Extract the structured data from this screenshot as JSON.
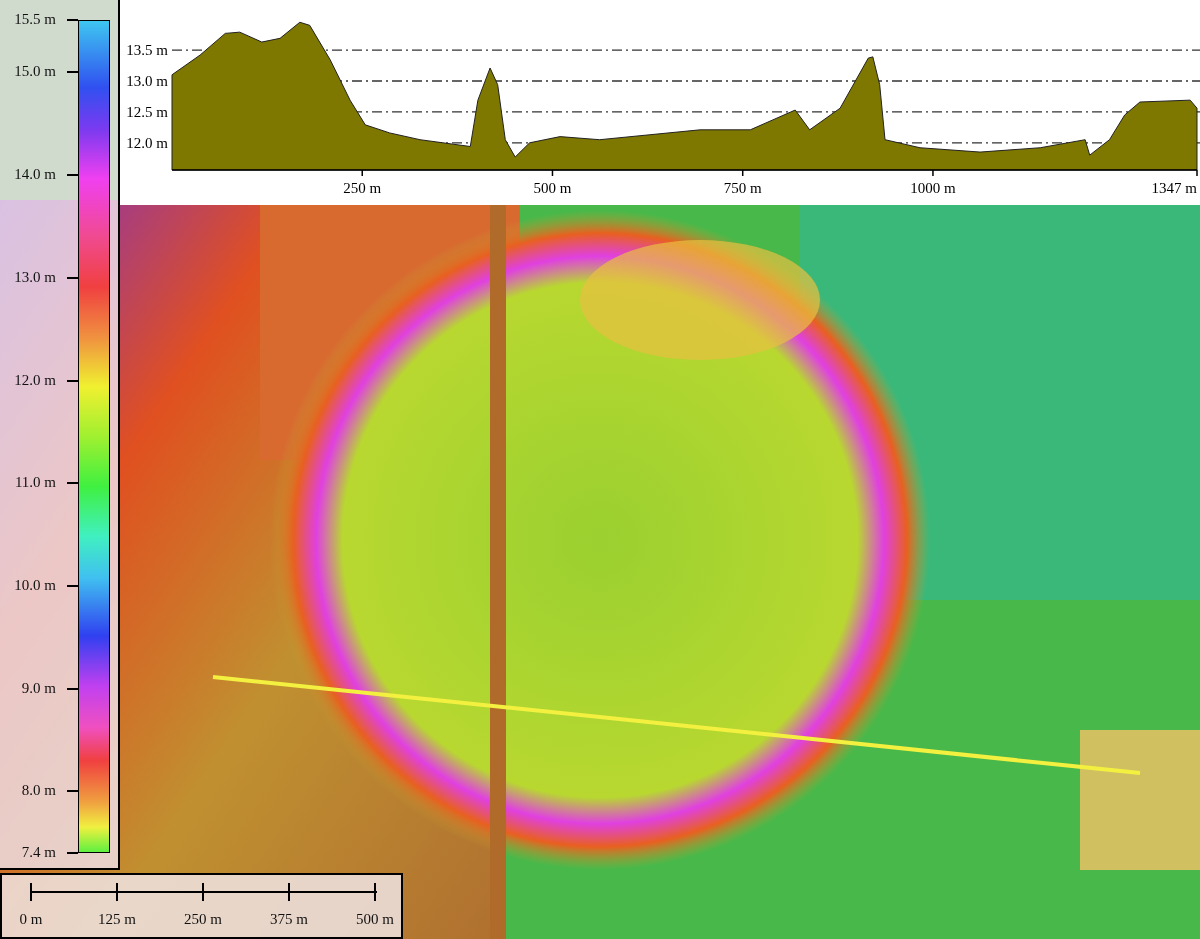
{
  "legend": {
    "labels": [
      "15.5 m",
      "15.0 m",
      "14.0 m",
      "13.0 m",
      "12.0 m",
      "11.0 m",
      "10.0 m",
      "9.0 m",
      "8.0 m",
      "7.4 m"
    ]
  },
  "profile": {
    "chart_data": {
      "type": "area",
      "x": [
        0,
        37,
        70,
        89,
        118,
        142,
        168,
        181,
        208,
        234,
        254,
        286,
        326,
        392,
        402,
        418,
        428,
        438,
        451,
        470,
        510,
        562,
        628,
        694,
        760,
        819,
        838,
        878,
        915,
        921,
        930,
        937,
        983,
        1062,
        1141,
        1200,
        1206,
        1232,
        1252,
        1272,
        1338,
        1347
      ],
      "grid": true,
      "series": [
        {
          "color": "#7f7800",
          "values": [
            13.1,
            13.42,
            13.77,
            13.79,
            13.63,
            13.69,
            13.95,
            13.9,
            13.34,
            12.69,
            12.29,
            12.16,
            12.05,
            11.94,
            12.69,
            13.21,
            12.94,
            12.05,
            11.77,
            12.0,
            12.1,
            12.05,
            12.13,
            12.21,
            12.21,
            12.53,
            12.21,
            12.56,
            13.37,
            13.39,
            12.94,
            12.05,
            11.92,
            11.85,
            11.92,
            12.05,
            11.8,
            12.05,
            12.45,
            12.66,
            12.69,
            12.56
          ]
        }
      ],
      "xlim": [
        0,
        1347
      ],
      "ylim": [
        11.56,
        14.31
      ],
      "xticks": [
        {
          "value": 250,
          "label": "250 m"
        },
        {
          "value": 500,
          "label": "500 m"
        },
        {
          "value": 750,
          "label": "750 m"
        },
        {
          "value": 1000,
          "label": "1000 m"
        },
        {
          "value": 1347,
          "label": "1347 m"
        }
      ],
      "yticks": [
        {
          "value": 12,
          "label": "12.0 m"
        },
        {
          "value": 12.5,
          "label": "12.5 m"
        },
        {
          "value": 13,
          "label": "13.0 m"
        },
        {
          "value": 13.5,
          "label": "13.5 m"
        }
      ]
    }
  },
  "scale_bar": {
    "labels": [
      "0 m",
      "125 m",
      "250 m",
      "375 m",
      "500 m"
    ]
  }
}
